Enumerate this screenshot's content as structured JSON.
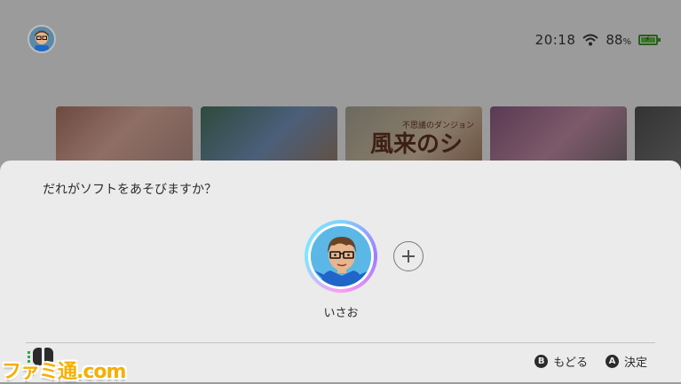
{
  "status": {
    "time": "20:18",
    "battery_percent": "88",
    "percent_sign": "%"
  },
  "home": {
    "tiles": [
      {
        "title": ""
      },
      {
        "title": ""
      },
      {
        "title": "風来のシレン",
        "subtitle": "不思議のダンジョン"
      },
      {
        "title": ""
      },
      {
        "title": ""
      }
    ]
  },
  "dialog": {
    "prompt": "だれがソフトをあそびますか？",
    "users": [
      {
        "name": "いさお"
      }
    ],
    "footer": {
      "back": {
        "key": "B",
        "label": "もどる"
      },
      "confirm": {
        "key": "A",
        "label": "決定"
      }
    }
  },
  "watermark": "ファミ通.com",
  "colors": {
    "sheet": "#ebebeb",
    "dim_background": "#9b9b9b",
    "battery": "#3a7a25",
    "avatar_bg": "#5bb8e6",
    "watermark": "#f5b000"
  }
}
